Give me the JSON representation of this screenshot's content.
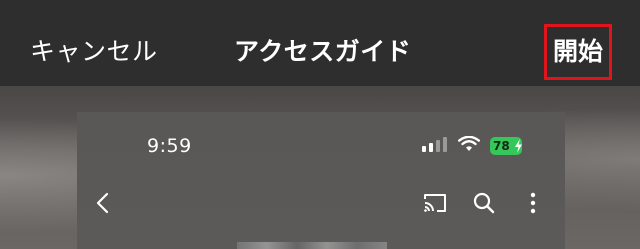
{
  "navbar": {
    "cancel_label": "キャンセル",
    "title": "アクセスガイド",
    "start_label": "開始",
    "highlight_color": "#e0141b"
  },
  "preview": {
    "status_time": "9:59",
    "battery_level": "78",
    "battery_color": "#35c759",
    "icons": [
      "cellular-signal-icon",
      "wifi-icon",
      "battery-icon",
      "back-chevron-icon",
      "cast-icon",
      "search-icon",
      "more-vertical-icon"
    ]
  }
}
